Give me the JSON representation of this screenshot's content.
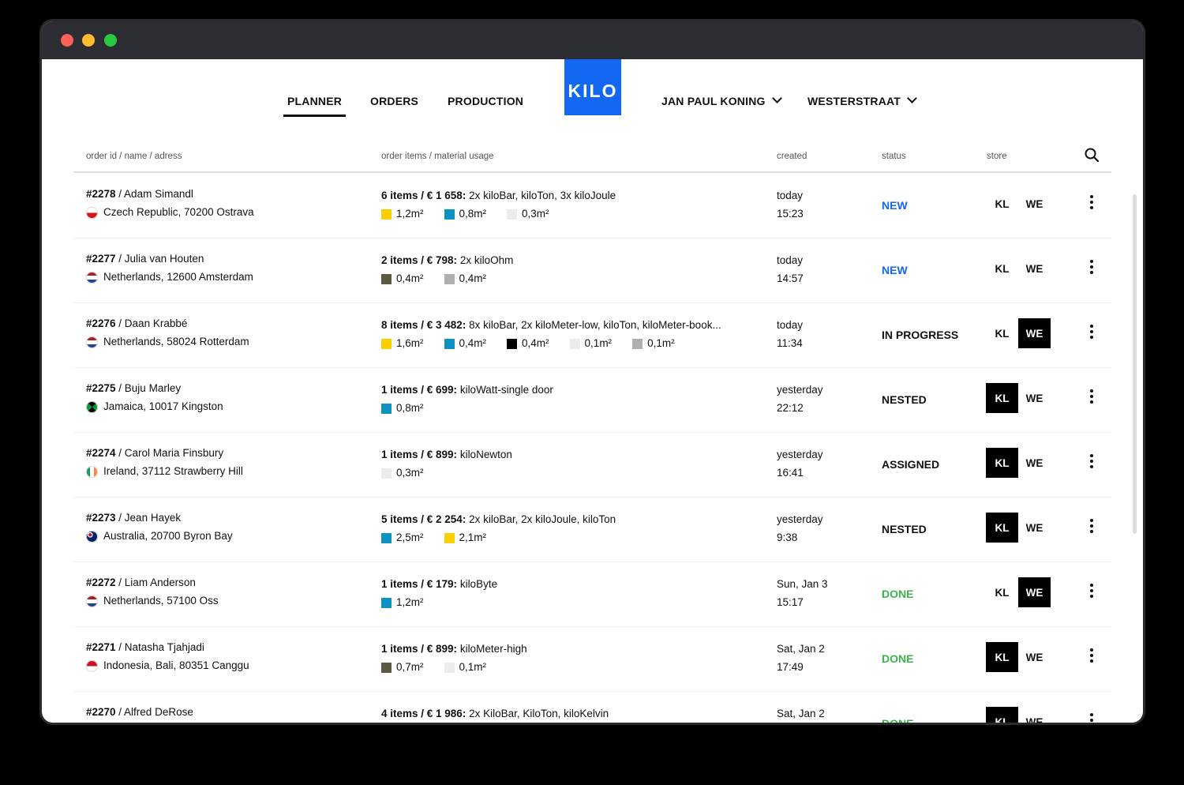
{
  "window": {
    "dots": [
      "close",
      "minimize",
      "zoom"
    ]
  },
  "nav": {
    "planner": "PLANNER",
    "orders": "ORDERS",
    "production": "PRODUCTION",
    "logo": "KILO",
    "user": "JAN PAUL KONING",
    "location": "WESTERSTRAAT"
  },
  "table": {
    "headers": {
      "order": "order id / name / adress",
      "items": "order items / material usage",
      "created": "created",
      "status": "status",
      "store": "store"
    },
    "store_labels": {
      "kl": "KL",
      "we": "WE"
    },
    "colors": {
      "new": "#1268f3",
      "done": "#3bb54a",
      "accent": "#1268f3",
      "yellow": "#fccf03",
      "blue": "#0d92c2",
      "lightgray": "#ececec",
      "olive": "#5b5a41",
      "gray": "#b0b0b0",
      "black": "#000000"
    },
    "rows": [
      {
        "id": "#2278",
        "name": " / Adam Simandl",
        "flag": "cz",
        "address": "Czech Republic, 70200 Ostrava",
        "items_bold": "6 items / € 1 658:",
        "items_rest": " 2x kiloBar, kiloTon, 3x kiloJoule",
        "materials": [
          {
            "color": "yellow",
            "value": "1,2m²"
          },
          {
            "color": "blue",
            "value": "0,8m²"
          },
          {
            "color": "lightgray",
            "value": "0,3m²"
          }
        ],
        "created_day": "today",
        "created_time": "15:23",
        "status": "NEW",
        "status_color": "#1268f3",
        "store_active": ""
      },
      {
        "id": "#2277",
        "name": " / Julia van Houten",
        "flag": "nl",
        "address": "Netherlands, 12600 Amsterdam",
        "items_bold": "2 items / € 798:",
        "items_rest": " 2x kiloOhm",
        "materials": [
          {
            "color": "olive",
            "value": "0,4m²"
          },
          {
            "color": "gray",
            "value": "0,4m²"
          }
        ],
        "created_day": "today",
        "created_time": "14:57",
        "status": "NEW",
        "status_color": "#1268f3",
        "store_active": ""
      },
      {
        "id": "#2276",
        "name": " / Daan Krabbé",
        "flag": "nl",
        "address": "Netherlands, 58024 Rotterdam",
        "items_bold": "8 items / € 3 482:",
        "items_rest": " 8x kiloBar, 2x kiloMeter-low, kiloTon, kiloMeter-book...",
        "materials": [
          {
            "color": "yellow",
            "value": "1,6m²"
          },
          {
            "color": "blue",
            "value": "0,4m²"
          },
          {
            "color": "black",
            "value": "0,4m²"
          },
          {
            "color": "lightgray",
            "value": "0,1m²"
          },
          {
            "color": "gray",
            "value": "0,1m²"
          }
        ],
        "created_day": "today",
        "created_time": "11:34",
        "status": "IN PROGRESS",
        "status_color": "#111111",
        "store_active": "we"
      },
      {
        "id": "#2275",
        "name": " / Buju Marley",
        "flag": "jm",
        "address": "Jamaica, 10017 Kingston",
        "items_bold": "1 items / € 699:",
        "items_rest": " kiloWatt-single door",
        "materials": [
          {
            "color": "blue",
            "value": "0,8m²"
          }
        ],
        "created_day": "yesterday",
        "created_time": "22:12",
        "status": "NESTED",
        "status_color": "#111111",
        "store_active": "kl"
      },
      {
        "id": "#2274",
        "name": " / Carol Maria Finsbury",
        "flag": "ie",
        "address": "Ireland, 37112 Strawberry Hill",
        "items_bold": "1 items / € 899:",
        "items_rest": " kiloNewton",
        "materials": [
          {
            "color": "lightgray",
            "value": "0,3m²"
          }
        ],
        "created_day": "yesterday",
        "created_time": "16:41",
        "status": "ASSIGNED",
        "status_color": "#111111",
        "store_active": "kl"
      },
      {
        "id": "#2273",
        "name": " / Jean Hayek",
        "flag": "au",
        "address": "Australia, 20700 Byron Bay",
        "items_bold": "5 items / € 2 254:",
        "items_rest": " 2x kiloBar, 2x kiloJoule, kiloTon",
        "materials": [
          {
            "color": "blue",
            "value": "2,5m²"
          },
          {
            "color": "yellow",
            "value": "2,1m²"
          }
        ],
        "created_day": "yesterday",
        "created_time": "9:38",
        "status": "NESTED",
        "status_color": "#111111",
        "store_active": "kl"
      },
      {
        "id": "#2272",
        "name": " / Liam Anderson",
        "flag": "nl",
        "address": "Netherlands, 57100 Oss",
        "items_bold": "1 items / € 179:",
        "items_rest": " kiloByte",
        "materials": [
          {
            "color": "blue",
            "value": "1,2m²"
          }
        ],
        "created_day": "Sun, Jan 3",
        "created_time": "15:17",
        "status": "DONE",
        "status_color": "#3bb54a",
        "store_active": "we"
      },
      {
        "id": "#2271",
        "name": " / Natasha Tjahjadi",
        "flag": "id",
        "address": "Indonesia, Bali, 80351 Canggu",
        "items_bold": "1 items / € 899:",
        "items_rest": " kiloMeter-high",
        "materials": [
          {
            "color": "olive",
            "value": "0,7m²"
          },
          {
            "color": "lightgray",
            "value": "0,1m²"
          }
        ],
        "created_day": "Sat, Jan 2",
        "created_time": "17:49",
        "status": "DONE",
        "status_color": "#3bb54a",
        "store_active": "kl"
      },
      {
        "id": "#2270",
        "name": " / Alfred DeRose",
        "flag": "",
        "address": "",
        "items_bold": "4 items / € 1 986:",
        "items_rest": " 2x KiloBar, KiloTon, kiloKelvin",
        "materials": [],
        "created_day": "Sat, Jan 2",
        "created_time": "",
        "status": "DONE",
        "status_color": "#3bb54a",
        "store_active": "kl"
      }
    ]
  }
}
